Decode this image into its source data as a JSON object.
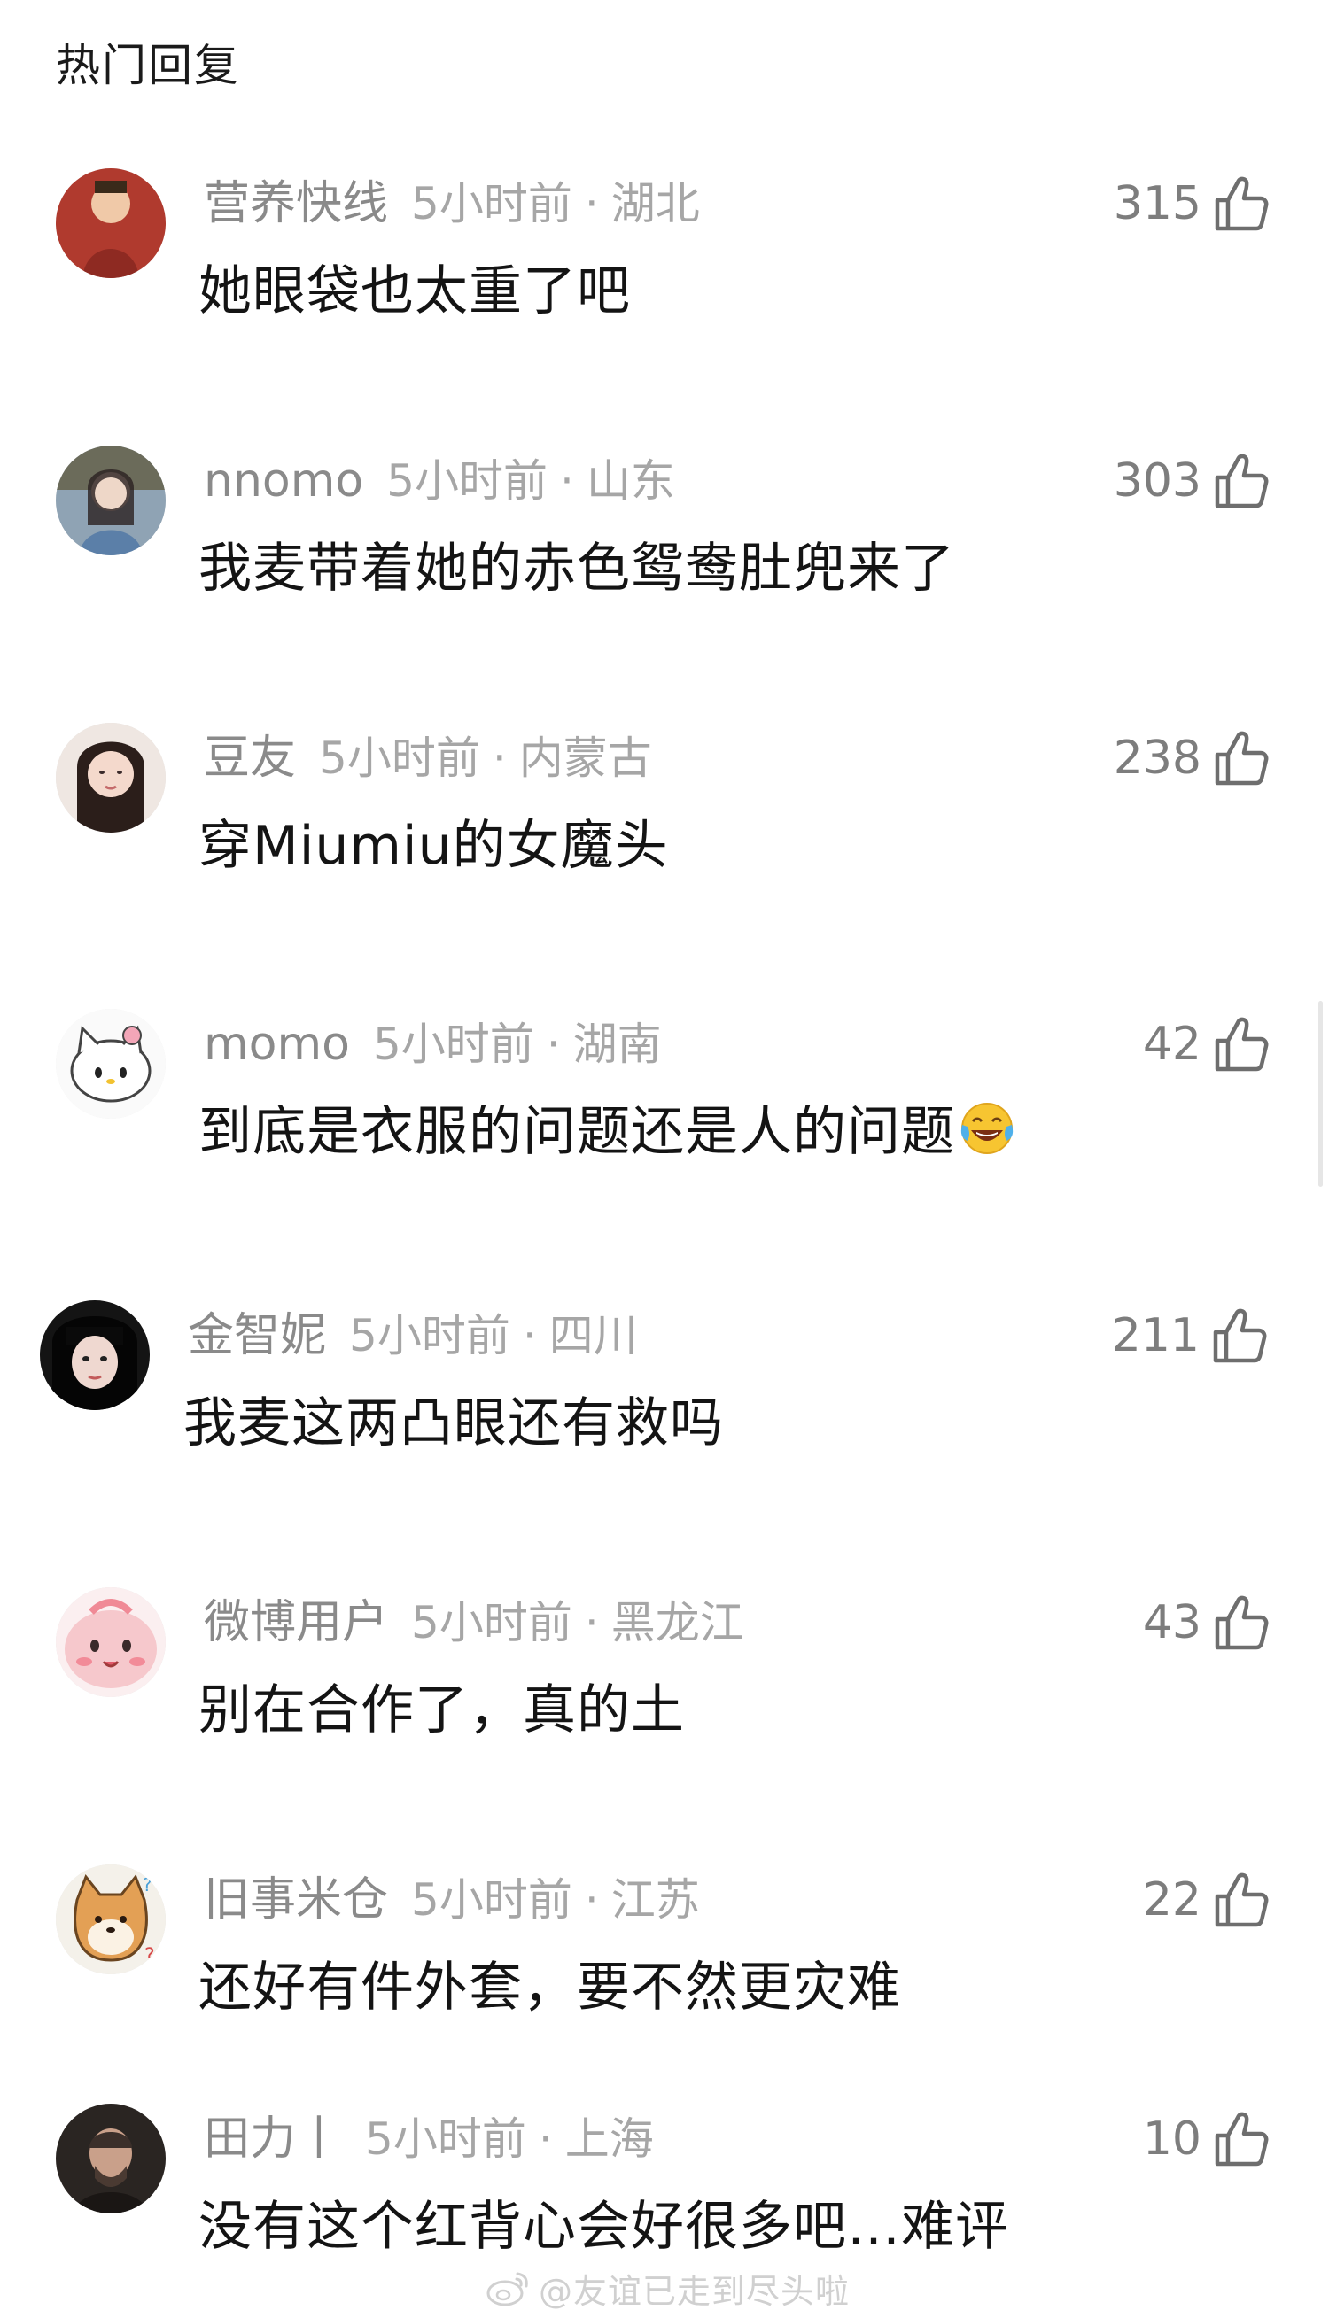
{
  "section": {
    "title": "热门回复"
  },
  "comments": [
    {
      "username": "营养快线",
      "time": "5小时前",
      "location": "湖北",
      "likes": "315",
      "text": "她眼袋也太重了吧"
    },
    {
      "username": "nnomo",
      "time": "5小时前",
      "location": "山东",
      "likes": "303",
      "text": "我麦带着她的赤色鸳鸯肚兜来了"
    },
    {
      "username": "豆友",
      "time": "5小时前",
      "location": "内蒙古",
      "likes": "238",
      "text": "穿Miumiu的女魔头"
    },
    {
      "username": "momo",
      "time": "5小时前",
      "location": "湖南",
      "likes": "42",
      "text": "到底是衣服的问题还是人的问题"
    },
    {
      "username": "金智妮",
      "time": "5小时前",
      "location": "四川",
      "likes": "211",
      "text": "我麦这两凸眼还有救吗"
    },
    {
      "username": "微博用户",
      "time": "5小时前",
      "location": "黑龙江",
      "likes": "43",
      "text": "别在合作了，真的土"
    },
    {
      "username": "旧事米仓",
      "time": "5小时前",
      "location": "江苏",
      "likes": "22",
      "text": "还好有件外套，要不然更灾难"
    },
    {
      "username": "田力丨",
      "time": "5小时前",
      "location": "上海",
      "likes": "10",
      "text": "没有这个红背心会好很多吧…难评"
    }
  ],
  "separator": "·",
  "watermark": {
    "text": "@友谊已走到尽头啦"
  },
  "icons": {
    "like": "thumbs-up-icon",
    "emoji": "laughing-tears-emoji",
    "watermark": "weibo-logo-icon"
  },
  "colors": {
    "username": "#8a8a8a",
    "meta": "#a6a6a6",
    "text": "#141414",
    "likes": "#7d7d7d"
  }
}
